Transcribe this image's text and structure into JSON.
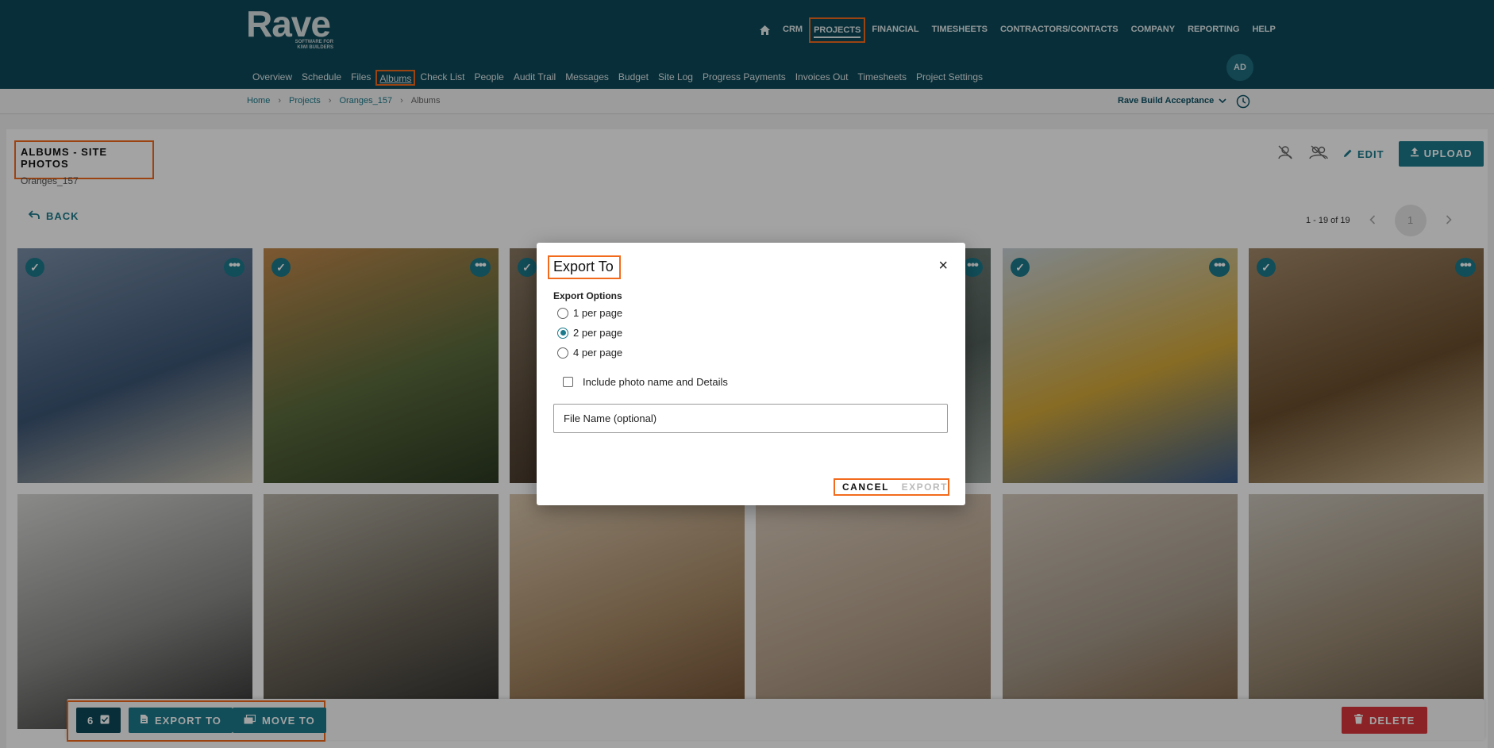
{
  "app": {
    "logo": "Rave",
    "tagline": "SOFTWARE FOR KIWI BUILDERS",
    "avatar_initials": "AD"
  },
  "top_nav": {
    "items": [
      "CRM",
      "PROJECTS",
      "FINANCIAL",
      "TIMESHEETS",
      "CONTRACTORS/CONTACTS",
      "COMPANY",
      "REPORTING",
      "HELP"
    ],
    "active": "PROJECTS"
  },
  "sub_nav": {
    "items": [
      "Overview",
      "Schedule",
      "Files",
      "Albums",
      "Check List",
      "People",
      "Audit Trail",
      "Messages",
      "Budget",
      "Site Log",
      "Progress Payments",
      "Invoices Out",
      "Timesheets",
      "Project Settings"
    ],
    "active": "Albums"
  },
  "breadcrumb": {
    "items": [
      "Home",
      "Projects",
      "Oranges_157"
    ],
    "current": "Albums"
  },
  "project_selector": "Rave Build Acceptance",
  "album": {
    "title": "ALBUMS - SITE PHOTOS",
    "subtitle": "Oranges_157"
  },
  "actions": {
    "edit": "EDIT",
    "upload": "UPLOAD",
    "back": "BACK"
  },
  "pagination": {
    "range": "1 - 19 of 19",
    "page": "1"
  },
  "photos": [
    {
      "name": "photo-measuring-tape",
      "selected": true,
      "colors": [
        "#7a8fa8",
        "#3d5675",
        "#c8c2b2"
      ]
    },
    {
      "name": "photo-house-frame-sunset",
      "selected": true,
      "colors": [
        "#c28a4d",
        "#5b6b3d",
        "#2c3a22"
      ]
    },
    {
      "name": "photo-hidden-3",
      "selected": true,
      "colors": [
        "#8a7a64",
        "#5a4a3a",
        "#3a2d22"
      ]
    },
    {
      "name": "photo-hidden-4",
      "selected": true,
      "colors": [
        "#7e8c85",
        "#55625d",
        "#9aa39c"
      ]
    },
    {
      "name": "photo-builders-tablet",
      "selected": true,
      "colors": [
        "#c8d2d8",
        "#d4a93a",
        "#3a5b8a"
      ]
    },
    {
      "name": "photo-tool-belt",
      "selected": true,
      "colors": [
        "#a48a6a",
        "#6a4e2e",
        "#c9b48e"
      ]
    },
    {
      "name": "photo-calculator-plans",
      "selected": false,
      "colors": [
        "#d8d8d6",
        "#8a8a88",
        "#2c2c2c"
      ]
    },
    {
      "name": "photo-man-wall-sketches",
      "selected": false,
      "colors": [
        "#b8b4a8",
        "#6a6458",
        "#2a2a2a"
      ]
    },
    {
      "name": "photo-beach-bowl",
      "selected": false,
      "colors": [
        "#d9c6ad",
        "#a88a66",
        "#6a4a2e"
      ]
    },
    {
      "name": "photo-beach-sand",
      "selected": false,
      "colors": [
        "#dcccbc",
        "#b8a48e",
        "#8f7a66"
      ]
    },
    {
      "name": "photo-picnic-basket",
      "selected": false,
      "colors": [
        "#d4c9bc",
        "#a69a8a",
        "#7a5c3e"
      ]
    },
    {
      "name": "photo-blueprint-hands",
      "selected": false,
      "colors": [
        "#cbc6bc",
        "#9a8a74",
        "#5c4e3c"
      ]
    }
  ],
  "dialog": {
    "title": "Export To",
    "options_label": "Export Options",
    "options": [
      "1 per page",
      "2 per page",
      "4 per page"
    ],
    "selected_option": "2 per page",
    "checkbox_label": "Include photo name and Details",
    "file_placeholder": "File Name (optional)",
    "cancel": "CANCEL",
    "export": "EXPORT",
    "close": "×"
  },
  "bottom_bar": {
    "selected_count": "6",
    "export_to": "EXPORT TO",
    "move_to": "MOVE TO",
    "delete": "DELETE"
  }
}
